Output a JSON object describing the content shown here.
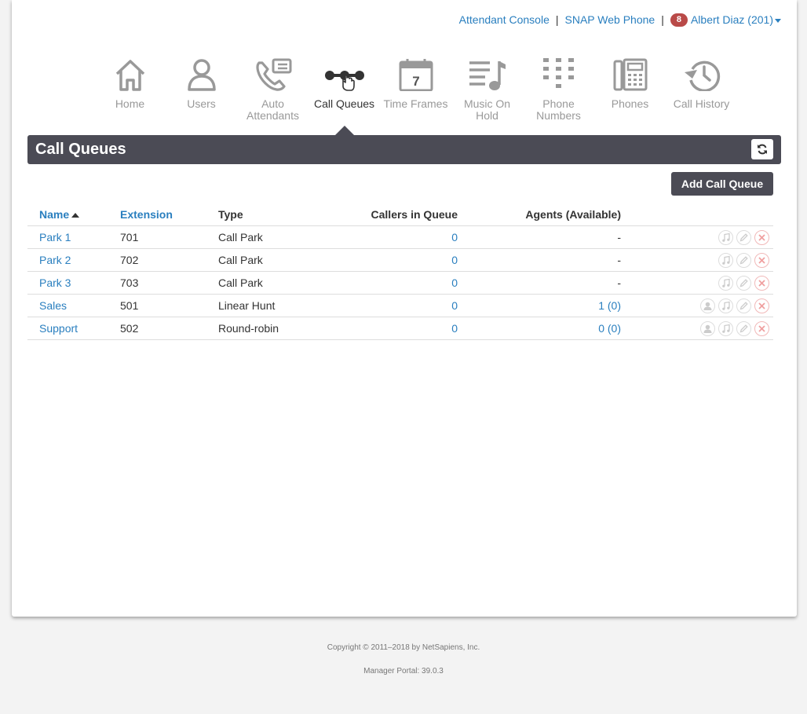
{
  "topbar": {
    "attendant_console": "Attendant Console",
    "sep1": "|",
    "snap_web_phone": "SNAP Web Phone",
    "sep2": "|",
    "notif_count": "8",
    "user": "Albert Diaz (201)"
  },
  "nav": {
    "home": "Home",
    "users": "Users",
    "auto_attendants": "Auto Attendants",
    "call_queues": "Call Queues",
    "time_frames": "Time Frames",
    "music_on_hold": "Music On Hold",
    "phone_numbers": "Phone Numbers",
    "phones": "Phones",
    "call_history": "Call History",
    "calendar_day": "7"
  },
  "panel": {
    "title": "Call Queues",
    "add_button": "Add Call Queue"
  },
  "table": {
    "headers": {
      "name": "Name",
      "extension": "Extension",
      "type": "Type",
      "callers": "Callers in Queue",
      "agents": "Agents (Available)"
    },
    "rows": [
      {
        "name": "Park 1",
        "extension": "701",
        "type": "Call Park",
        "callers": "0",
        "agents": "-"
      },
      {
        "name": "Park 2",
        "extension": "702",
        "type": "Call Park",
        "callers": "0",
        "agents": "-"
      },
      {
        "name": "Park 3",
        "extension": "703",
        "type": "Call Park",
        "callers": "0",
        "agents": "-"
      },
      {
        "name": "Sales",
        "extension": "501",
        "type": "Linear Hunt",
        "callers": "0",
        "agents": "1 (0)"
      },
      {
        "name": "Support",
        "extension": "502",
        "type": "Round-robin",
        "callers": "0",
        "agents": "0 (0)"
      }
    ]
  },
  "footer": {
    "copyright": "Copyright © 2011–2018 by NetSapiens, Inc.",
    "version": "Manager Portal: 39.0.3"
  },
  "colors": {
    "link": "#2a7fbf",
    "header_bg": "#4b4b55",
    "badge": "#b94a48"
  },
  "icons": [
    "home-icon",
    "users-icon",
    "auto-attendants-icon",
    "call-queues-icon",
    "time-frames-icon",
    "music-on-hold-icon",
    "phone-numbers-icon",
    "phones-icon",
    "call-history-icon",
    "refresh-icon",
    "agents-icon",
    "music-icon",
    "edit-icon",
    "delete-icon"
  ]
}
